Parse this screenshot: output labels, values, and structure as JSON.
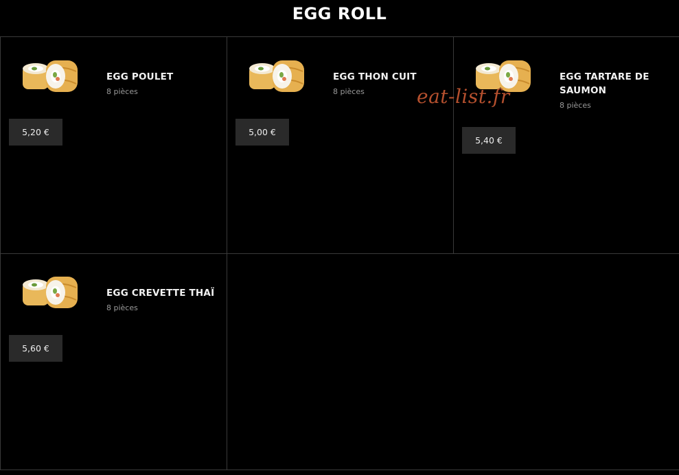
{
  "page": {
    "title": "EGG ROLL"
  },
  "watermark": "eat-list.fr",
  "colors": {
    "background": "#000000",
    "price_bg": "#2a2a2a",
    "watermark": "#b5502e"
  },
  "items": [
    {
      "name": "EGG POULET",
      "pieces": "8 pièces",
      "price": "5,20 €",
      "image_icon": "egg-roll-sushi"
    },
    {
      "name": "EGG THON CUIT",
      "pieces": "8 pièces",
      "price": "5,00 €",
      "image_icon": "egg-roll-sushi"
    },
    {
      "name": "EGG TARTARE DE SAUMON",
      "pieces": "8 pièces",
      "price": "5,40 €",
      "image_icon": "egg-roll-sushi"
    },
    {
      "name": "EGG CREVETTE THAÏ",
      "pieces": "8 pièces",
      "price": "5,60 €",
      "image_icon": "egg-roll-sushi"
    }
  ]
}
